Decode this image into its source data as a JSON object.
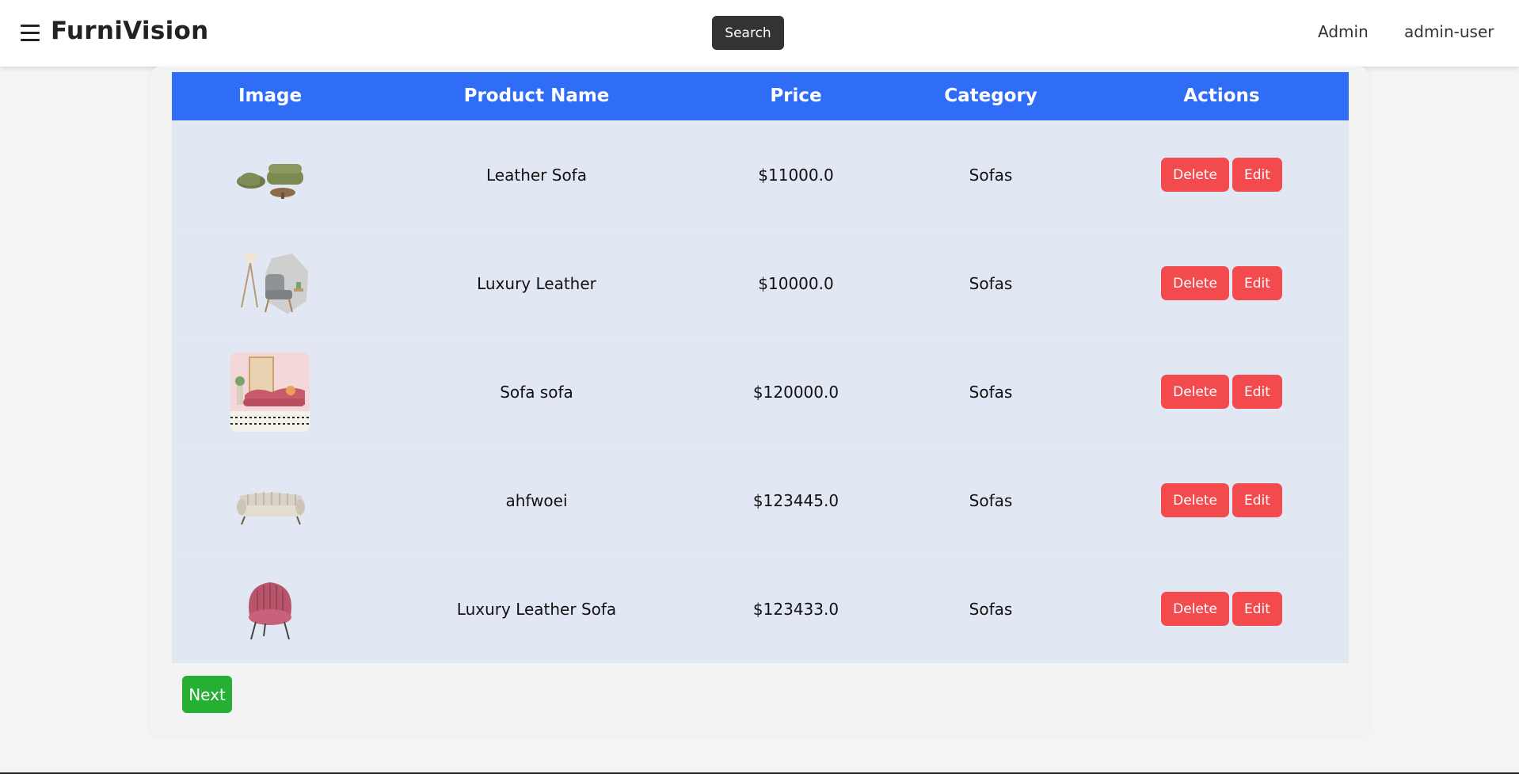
{
  "header": {
    "brand": "FurniVision",
    "menu_icon": "hamburger-menu-icon",
    "search_label": "Search",
    "nav": [
      "Admin",
      "admin-user"
    ]
  },
  "table": {
    "columns": [
      "Image",
      "Product Name",
      "Price",
      "Category",
      "Actions"
    ],
    "rows": [
      {
        "name": "Leather Sofa",
        "price": "$11000.0",
        "category": "Sofas",
        "delete_label": "Delete",
        "edit_label": "Edit"
      },
      {
        "name": "Luxury Leather",
        "price": "$10000.0",
        "category": "Sofas",
        "delete_label": "Delete",
        "edit_label": "Edit"
      },
      {
        "name": "Sofa sofa",
        "price": "$120000.0",
        "category": "Sofas",
        "delete_label": "Delete",
        "edit_label": "Edit"
      },
      {
        "name": "ahfwoei",
        "price": "$123445.0",
        "category": "Sofas",
        "delete_label": "Delete",
        "edit_label": "Edit"
      },
      {
        "name": "Luxury Leather Sofa",
        "price": "$123433.0",
        "category": "Sofas",
        "delete_label": "Delete",
        "edit_label": "Edit"
      }
    ]
  },
  "pagination": {
    "next_label": "Next"
  },
  "colors": {
    "header_bg": "#2f6df6",
    "row_bg": "#e1e7f3",
    "delete_button": "#f24a4d",
    "edit_button": "#f24a4d",
    "next_button": "#25b033",
    "search_button": "#333333"
  }
}
